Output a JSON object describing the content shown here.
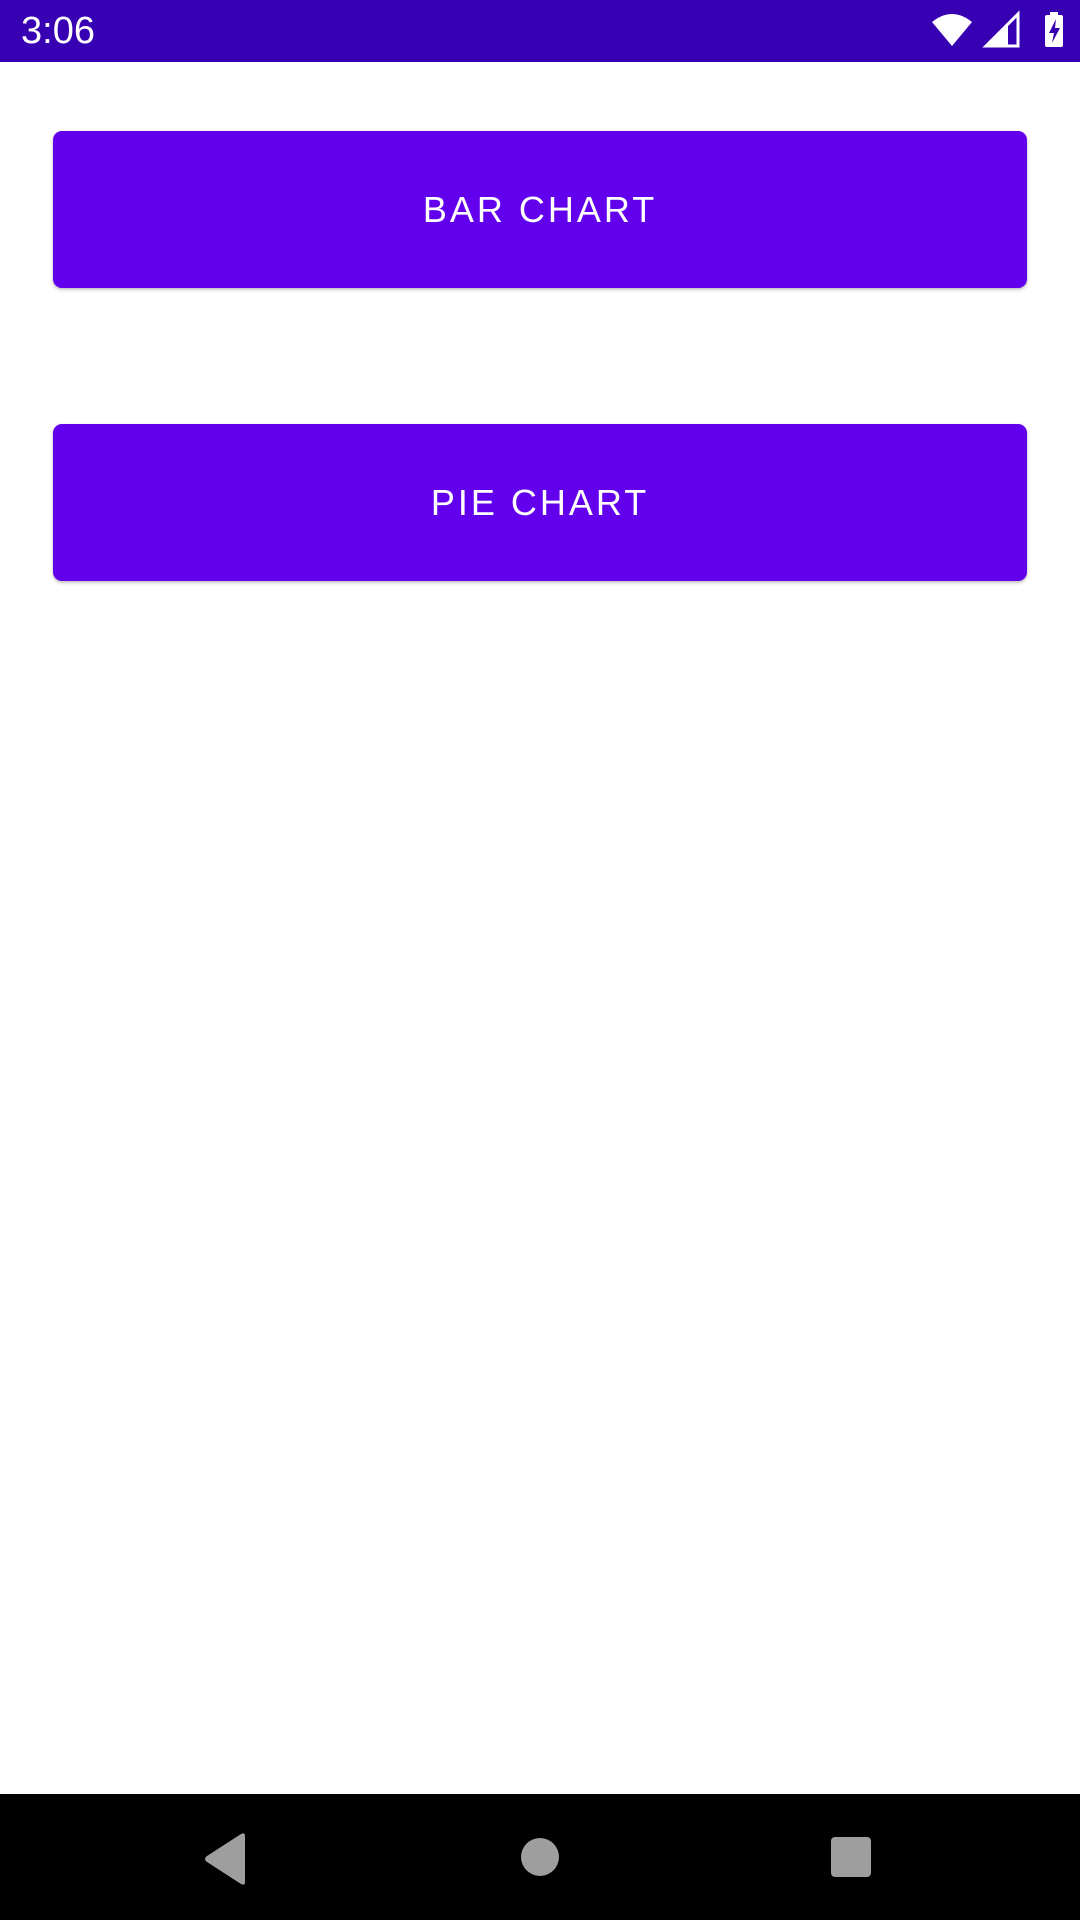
{
  "status_bar": {
    "time": "3:06",
    "background_color": "#3700b3",
    "icons": [
      "wifi-icon",
      "cell-signal-icon",
      "battery-charging-icon"
    ]
  },
  "main": {
    "buttons": [
      {
        "label": "BAR CHART",
        "color": "#6200ee"
      },
      {
        "label": "PIE CHART",
        "color": "#6200ee"
      }
    ]
  },
  "nav_bar": {
    "background_color": "#000000",
    "icons": [
      "back-icon",
      "home-icon",
      "recents-icon"
    ]
  }
}
